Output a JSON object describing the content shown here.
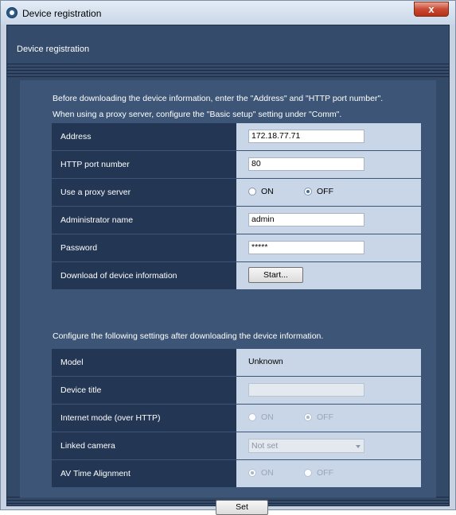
{
  "window": {
    "title": "Device registration",
    "close_label": "x"
  },
  "header": {
    "title": "Device registration"
  },
  "intro": {
    "line1": "Before downloading the device information, enter the \"Address\" and \"HTTP port number\".",
    "line2": "When using a proxy server, configure the \"Basic setup\" setting under \"Comm\"."
  },
  "connection": {
    "address": {
      "label": "Address",
      "value": "172.18.77.71"
    },
    "http_port": {
      "label": "HTTP port number",
      "value": "80"
    },
    "proxy": {
      "label": "Use a proxy server",
      "on_label": "ON",
      "off_label": "OFF",
      "selected": "OFF"
    },
    "admin_name": {
      "label": "Administrator name",
      "value": "admin"
    },
    "password": {
      "label": "Password",
      "value": "*****"
    },
    "download": {
      "label": "Download of device information",
      "button_label": "Start..."
    }
  },
  "settings_intro": "Configure the following settings after downloading the device information.",
  "settings": {
    "model": {
      "label": "Model",
      "value": "Unknown"
    },
    "device_title": {
      "label": "Device title",
      "value": ""
    },
    "internet_mode": {
      "label": "Internet mode (over HTTP)",
      "on_label": "ON",
      "off_label": "OFF",
      "selected": "OFF"
    },
    "linked_camera": {
      "label": "Linked camera",
      "value": "Not set"
    },
    "av_time": {
      "label": "AV Time Alignment",
      "on_label": "ON",
      "off_label": "OFF",
      "selected": "ON"
    }
  },
  "set_button_label": "Set"
}
